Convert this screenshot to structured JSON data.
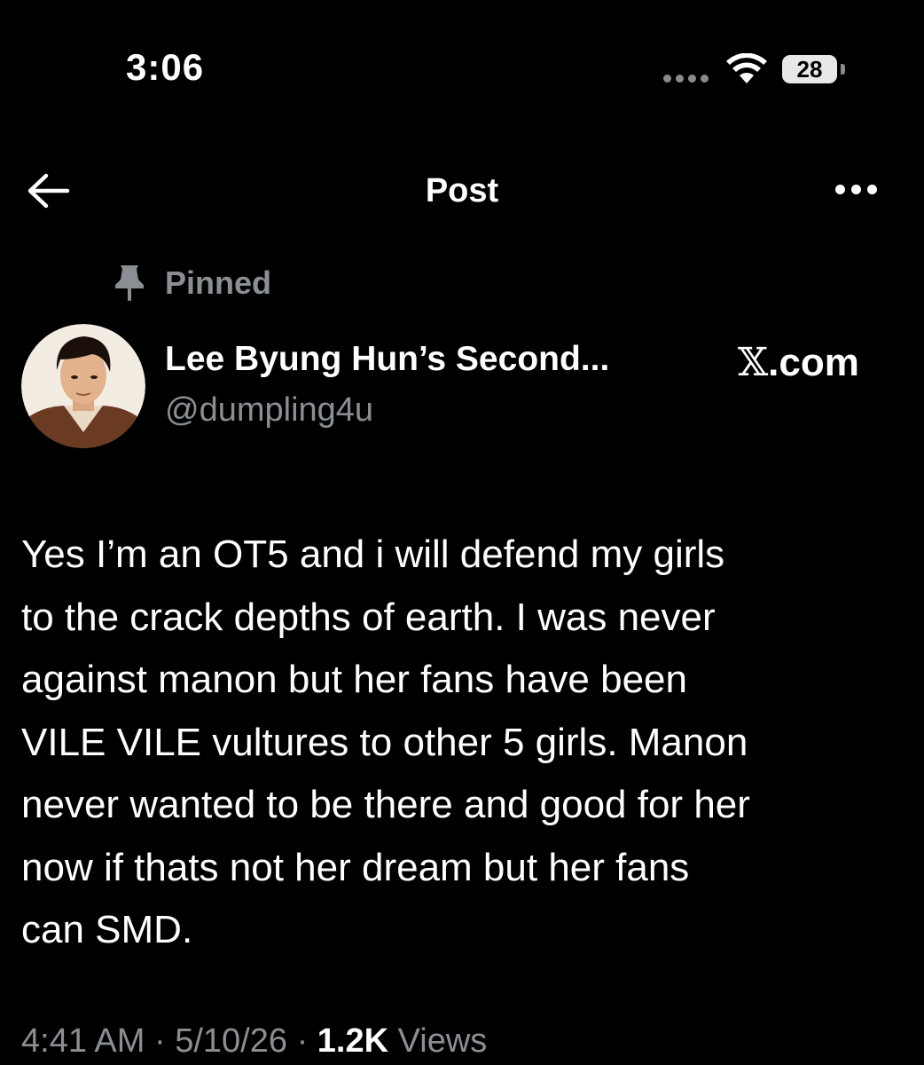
{
  "status_bar": {
    "time": "3:06",
    "battery": "28"
  },
  "header": {
    "title": "Post"
  },
  "post": {
    "pinned_label": "Pinned",
    "author": {
      "name": "Lee Byung Hun’s Second...",
      "handle": "@dumpling4u"
    },
    "source": {
      "logo": "𝕏",
      "text": ".com"
    },
    "body_lines": [
      "Yes I’m an OT5 and i will defend my girls",
      "to the crack depths of earth. I was never",
      "against manon but her fans have been",
      "VILE VILE vultures to other 5 girls. Manon",
      "never wanted to be there and good for her",
      "now if thats not her dream but her fans",
      "can SMD."
    ],
    "meta": {
      "time": "4:41 AM",
      "sep": "·",
      "date": "5/10/26",
      "views_count": "1.2K",
      "views_label": "Views"
    }
  },
  "icons": {
    "back": "arrow-left-icon",
    "more": "more-horizontal-icon",
    "pin": "pin-icon",
    "wifi": "wifi-icon"
  },
  "colors": {
    "background": "#000000",
    "text_primary": "#ffffff",
    "text_secondary": "#8b8f94"
  }
}
